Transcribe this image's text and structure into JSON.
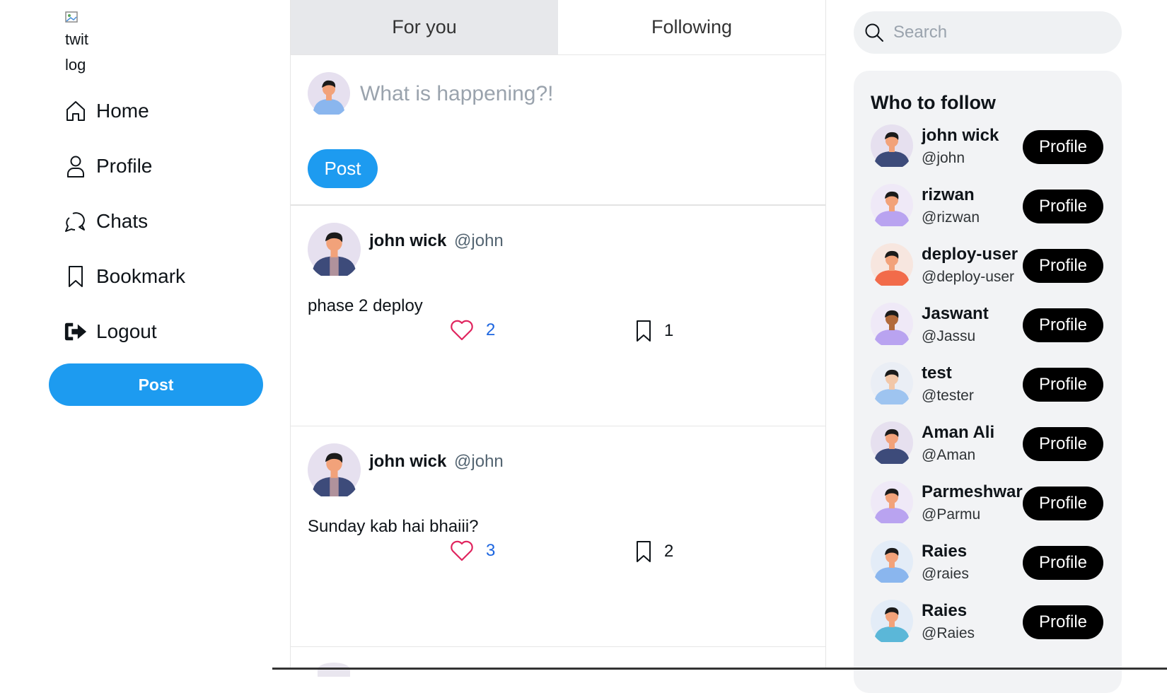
{
  "logo": {
    "alt_line1": "twit",
    "alt_line2": "log"
  },
  "nav": {
    "items": [
      {
        "label": "Home",
        "icon": "home-icon"
      },
      {
        "label": "Profile",
        "icon": "user-icon"
      },
      {
        "label": "Chats",
        "icon": "chat-icon"
      },
      {
        "label": "Bookmark",
        "icon": "bookmark-icon"
      },
      {
        "label": "Logout",
        "icon": "logout-icon"
      }
    ],
    "post_label": "Post"
  },
  "feed": {
    "tabs": [
      {
        "label": "For you",
        "active": true
      },
      {
        "label": "Following",
        "active": false
      }
    ],
    "composer": {
      "placeholder": "What is happening?!",
      "post_label": "Post"
    },
    "tweets": [
      {
        "name": "john wick",
        "handle": "@john",
        "text": "phase 2 deploy",
        "likes": "2",
        "bookmarks": "1"
      },
      {
        "name": "john wick",
        "handle": "@john",
        "text": "Sunday kab hai bhaiii?",
        "likes": "3",
        "bookmarks": "2"
      }
    ]
  },
  "search": {
    "placeholder": "Search"
  },
  "who_to_follow": {
    "title": "Who to follow",
    "button_label": "Profile",
    "users": [
      {
        "name": "john wick",
        "handle": "@john",
        "skin": "#f2a27a",
        "shirt": "#3d4b7a",
        "bg": "#e6e0ef"
      },
      {
        "name": "rizwan",
        "handle": "@rizwan",
        "skin": "#f2a27a",
        "shirt": "#b9a3f0",
        "bg": "#efe9f7"
      },
      {
        "name": "deploy-user",
        "handle": "@deploy-user",
        "skin": "#f2a27a",
        "shirt": "#f26b4a",
        "bg": "#f7e6df"
      },
      {
        "name": "Jaswant",
        "handle": "@Jassu",
        "skin": "#b26a3c",
        "shirt": "#b9a3f0",
        "bg": "#efe9f7"
      },
      {
        "name": "test",
        "handle": "@tester",
        "skin": "#f2c7a8",
        "shirt": "#9ec4f0",
        "bg": "#eaeef5"
      },
      {
        "name": "Aman Ali",
        "handle": "@Aman",
        "skin": "#f2a27a",
        "shirt": "#3d4b7a",
        "bg": "#e6e0ef"
      },
      {
        "name": "Parmeshwar",
        "handle": "@Parmu",
        "skin": "#f2a27a",
        "shirt": "#b9a3f0",
        "bg": "#efe9f7"
      },
      {
        "name": "Raies",
        "handle": "@raies",
        "skin": "#f2a27a",
        "shirt": "#8ab6ee",
        "bg": "#e3ecf7"
      },
      {
        "name": "Raies",
        "handle": "@Raies",
        "skin": "#f2a27a",
        "shirt": "#5bb7d8",
        "bg": "#e3ecf7"
      }
    ]
  },
  "colors": {
    "accent": "#1d9bf0",
    "like": "#e0245e",
    "count_blue": "#1d66e0"
  }
}
